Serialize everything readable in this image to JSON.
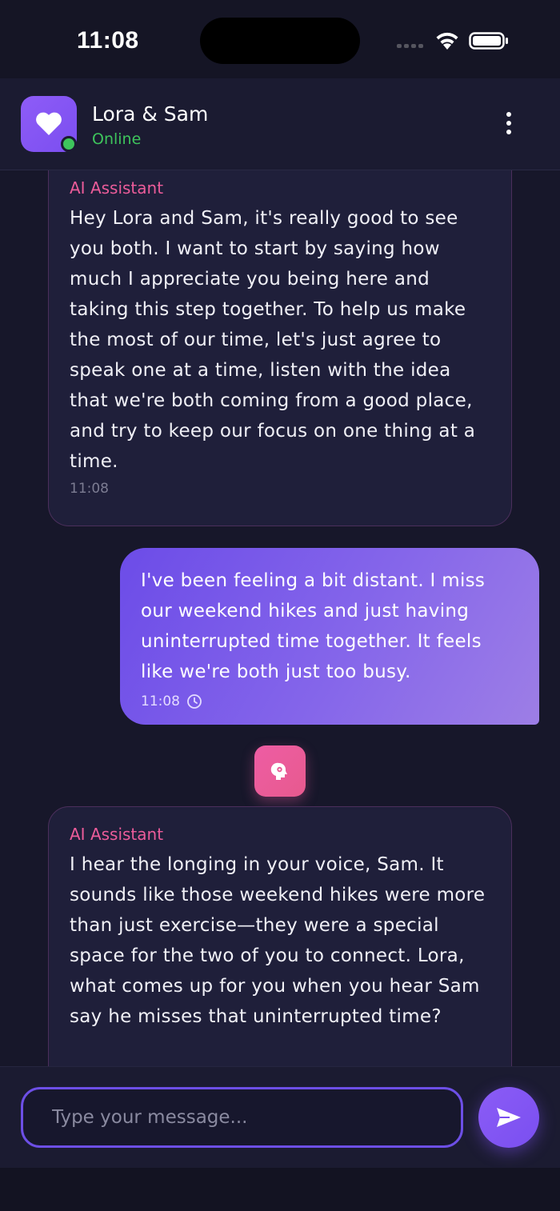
{
  "status_bar": {
    "time": "11:08"
  },
  "header": {
    "title": "Lora & Sam",
    "status": "Online",
    "avatar_icon": "heart-icon",
    "menu_icon": "more-vertical-icon"
  },
  "messages": [
    {
      "sender": "AI Assistant",
      "text": "Hey Lora and Sam, it's really good to see you both. I want to start by saying how much I appreciate you being here and taking this step together. To help us make the most of our time, let's just agree to speak one at a time, listen with the idea that we're both coming from a good place, and try to keep our focus on one thing at a time.",
      "time": "11:08"
    },
    {
      "sender": "user",
      "text": "I've been feeling a bit distant. I miss our weekend hikes and just having uninterrupted time together. It feels like we're both just too busy.",
      "time": "11:08",
      "status_icon": "clock-icon"
    },
    {
      "sender": "AI Assistant",
      "text": "I hear the longing in your voice, Sam. It sounds like those weekend hikes were more than just exercise—they were a special space for the two of you to connect. Lora, what comes up for you when you hear Sam say he misses that uninterrupted time?"
    }
  ],
  "thinking_icon": "brain-gear-icon",
  "composer": {
    "placeholder": "Type your message...",
    "send_icon": "send-icon"
  },
  "colors": {
    "accent": "#7c4ff0",
    "ai_label": "#ec5c9a",
    "online": "#3ec45c",
    "background": "#17172a"
  }
}
